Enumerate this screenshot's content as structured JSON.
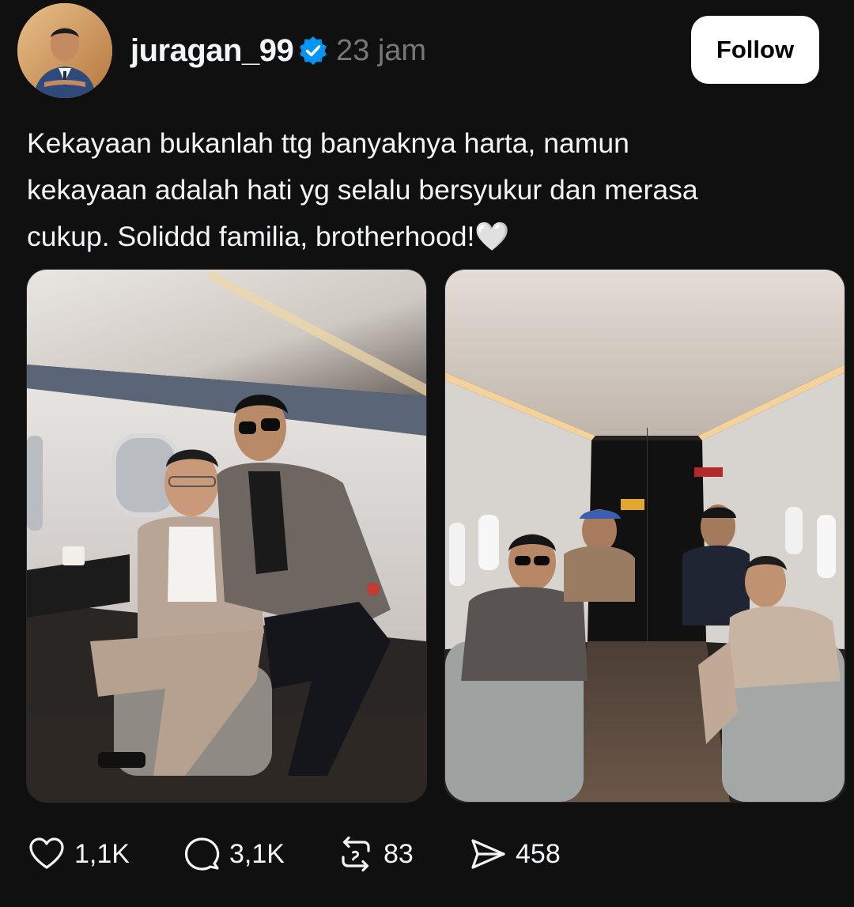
{
  "post": {
    "username": "juragan_99",
    "verified": true,
    "timestamp": "23 jam",
    "follow_label": "Follow",
    "caption": "Kekayaan bukanlah ttg banyaknya harta, namun\nkekayaan adalah hati yg selalu bersyukur dan merasa\ncukup. Soliddd familia, brotherhood!🤍",
    "images": [
      {
        "description": "two men sitting inside private jet cabin"
      },
      {
        "description": "four men seated in private jet cabin aisle"
      }
    ],
    "actions": {
      "likes": "1,1K",
      "replies": "3,1K",
      "reposts": "83",
      "shares": "458"
    }
  },
  "icons": {
    "verified": "verified-badge-icon",
    "like": "heart-icon",
    "reply": "speech-bubble-icon",
    "repost": "repost-arrows-icon",
    "share": "paper-plane-icon"
  },
  "colors": {
    "background": "#101010",
    "text_primary": "#f3f5f7",
    "text_secondary": "#777777",
    "verified_blue": "#0095f6",
    "follow_button_bg": "#ffffff"
  }
}
